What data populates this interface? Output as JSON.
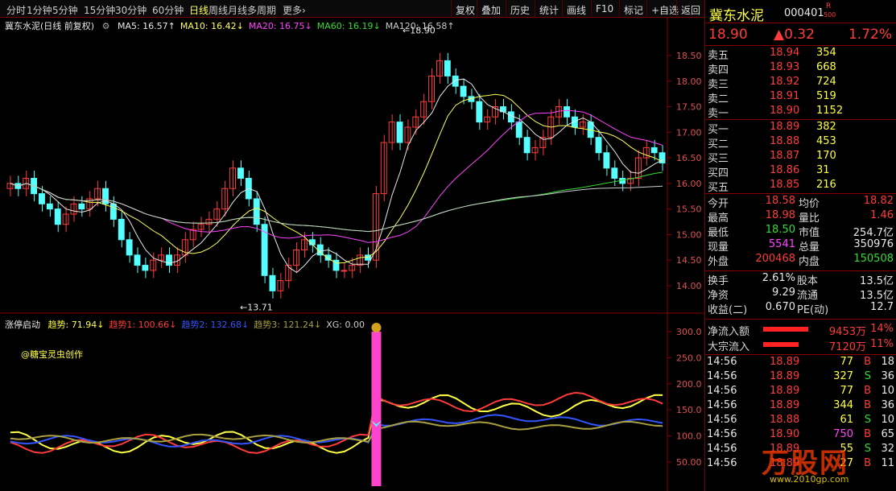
{
  "toolbar": {
    "periods": [
      "分时",
      "1分钟",
      "5分钟",
      "15分钟",
      "30分钟",
      "60分钟",
      "日线",
      "周线",
      "月线",
      "多周期",
      "更多"
    ],
    "more_arrow": "›",
    "actions": [
      "复权",
      "叠加",
      "历史",
      "统计",
      "画线",
      "F10",
      "标记",
      "+自选",
      "返回"
    ]
  },
  "main_chart": {
    "title": "冀东水泥(日线 前复权)",
    "ma_legend": [
      {
        "label": "MA5: 16.57",
        "arrow": "↑",
        "color": "#e8e8e8"
      },
      {
        "label": "MA10: 16.42",
        "arrow": "↓",
        "color": "#ffff55"
      },
      {
        "label": "MA20: 16.75",
        "arrow": "↓",
        "color": "#ff44ff"
      },
      {
        "label": "MA60: 16.19",
        "arrow": "↓",
        "color": "#33dd33"
      },
      {
        "label": "MA120: 16.58",
        "arrow": "↑",
        "color": "#cccccc"
      }
    ],
    "high_marker": "18.90",
    "low_marker": "13.71",
    "y_ticks": [
      "18.50",
      "18.00",
      "17.50",
      "17.00",
      "16.50",
      "16.00",
      "15.50",
      "15.00",
      "14.50",
      "14.00"
    ]
  },
  "indicator": {
    "name": "涨停启动",
    "legend": [
      {
        "label": "趋势: 71.94",
        "arrow": "↓",
        "color": "#ffff44"
      },
      {
        "label": "趋势1: 100.66",
        "arrow": "↓",
        "color": "#ff3b3b"
      },
      {
        "label": "趋势2: 132.68",
        "arrow": "↓",
        "color": "#3355ff"
      },
      {
        "label": "趋势3: 121.24",
        "arrow": "↓",
        "color": "#a8a040"
      },
      {
        "label": "XG: 0.00",
        "arrow": "",
        "color": "#cccccc"
      }
    ],
    "credit": "@糖宝灵虫创作",
    "y_ticks": [
      "300.0",
      "250.0",
      "200.0",
      "150.0",
      "100.0",
      "50.00"
    ]
  },
  "quote": {
    "name": "冀东水泥",
    "code": "000401",
    "badge_top": "R",
    "badge_bottom": "500",
    "price": "18.90",
    "change": "▲0.32",
    "change_pct": "1.72%",
    "asks": [
      {
        "label": "卖五",
        "price": "18.94",
        "vol": "354"
      },
      {
        "label": "卖四",
        "price": "18.93",
        "vol": "668"
      },
      {
        "label": "卖三",
        "price": "18.92",
        "vol": "724"
      },
      {
        "label": "卖二",
        "price": "18.91",
        "vol": "519"
      },
      {
        "label": "卖一",
        "price": "18.90",
        "vol": "1152"
      }
    ],
    "bids": [
      {
        "label": "买一",
        "price": "18.89",
        "vol": "382"
      },
      {
        "label": "买二",
        "price": "18.88",
        "vol": "453"
      },
      {
        "label": "买三",
        "price": "18.87",
        "vol": "170"
      },
      {
        "label": "买四",
        "price": "18.86",
        "vol": "31"
      },
      {
        "label": "买五",
        "price": "18.85",
        "vol": "216"
      }
    ],
    "stats": [
      {
        "l1": "今开",
        "v1": "18.58",
        "c1": "red",
        "l2": "均价",
        "v2": "18.82",
        "c2": "red"
      },
      {
        "l1": "最高",
        "v1": "18.98",
        "c1": "red",
        "l2": "量比",
        "v2": "1.46",
        "c2": "red"
      },
      {
        "l1": "最低",
        "v1": "18.50",
        "c1": "green",
        "l2": "市值",
        "v2": "254.7亿",
        "c2": "white"
      },
      {
        "l1": "现量",
        "v1": "5541",
        "c1": "purple",
        "l2": "总量",
        "v2": "350976",
        "c2": "white"
      },
      {
        "l1": "外盘",
        "v1": "200468",
        "c1": "red",
        "l2": "内盘",
        "v2": "150508",
        "c2": "green"
      }
    ],
    "stats2": [
      {
        "l1": "换手",
        "v1": "2.61%",
        "l2": "股本",
        "v2": "13.5亿"
      },
      {
        "l1": "净资",
        "v1": "9.29",
        "l2": "流通",
        "v2": "13.5亿"
      },
      {
        "l1": "收益(二)",
        "v1": "0.670",
        "l2": "PE(动)",
        "v2": "12.7"
      }
    ],
    "flows": [
      {
        "label": "净流入额",
        "value": "9453万",
        "pct": "14%",
        "bar": 0.14
      },
      {
        "label": "大宗流入",
        "value": "7120万",
        "pct": "11%",
        "bar": 0.11
      }
    ],
    "ticks": [
      {
        "time": "14:56",
        "price": "18.89",
        "vol": "77",
        "side": "B",
        "n": "18",
        "pc": "red",
        "vc": "yellow",
        "sc": "red"
      },
      {
        "time": "14:56",
        "price": "18.89",
        "vol": "327",
        "side": "S",
        "n": "36",
        "pc": "red",
        "vc": "yellow",
        "sc": "green"
      },
      {
        "time": "14:56",
        "price": "18.89",
        "vol": "77",
        "side": "B",
        "n": "10",
        "pc": "red",
        "vc": "yellow",
        "sc": "red"
      },
      {
        "time": "14:56",
        "price": "18.89",
        "vol": "344",
        "side": "B",
        "n": "36",
        "pc": "red",
        "vc": "yellow",
        "sc": "red"
      },
      {
        "time": "14:56",
        "price": "18.88",
        "vol": "61",
        "side": "S",
        "n": "10",
        "pc": "red",
        "vc": "yellow",
        "sc": "green"
      },
      {
        "time": "14:56",
        "price": "18.90",
        "vol": "750",
        "side": "B",
        "n": "65",
        "pc": "red",
        "vc": "purple",
        "sc": "red"
      },
      {
        "time": "14:56",
        "price": "18.89",
        "vol": "55",
        "side": "S",
        "n": "32",
        "pc": "red",
        "vc": "yellow",
        "sc": "green"
      },
      {
        "time": "14:56",
        "price": "18.89",
        "vol": "27",
        "side": "B",
        "n": "11",
        "pc": "red",
        "vc": "yellow",
        "sc": "red"
      }
    ],
    "watermark": "万股网",
    "watermark_url": "www.2010gp.com"
  },
  "colors": {
    "up": "#ff3b3b",
    "down": "#55ffff",
    "border": "#880000",
    "ma5": "#e8e8e8",
    "ma10": "#ffff55",
    "ma20": "#ff44ff",
    "ma60": "#33dd33",
    "ma120": "#cccccc",
    "xg_bar": "#ff44cc"
  }
}
